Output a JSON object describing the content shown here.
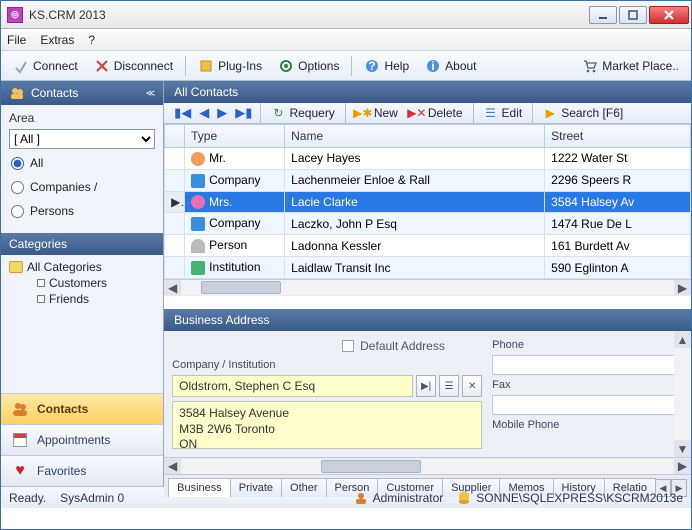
{
  "window": {
    "title": "KS.CRM 2013"
  },
  "menu": {
    "file": "File",
    "extras": "Extras",
    "help": "?"
  },
  "toolbar": {
    "connect": "Connect",
    "disconnect": "Disconnect",
    "plugins": "Plug-Ins",
    "options": "Options",
    "help": "Help",
    "about": "About",
    "marketplace": "Market Place.."
  },
  "sidebar": {
    "contacts_title": "Contacts",
    "area_label": "Area",
    "area_value": "[ All ]",
    "radio_all": "All",
    "radio_companies": "Companies /",
    "radio_persons": "Persons",
    "categories_title": "Categories",
    "tree": {
      "root": "All Categories",
      "child1": "Customers",
      "child2": "Friends"
    },
    "nav": {
      "contacts": "Contacts",
      "appointments": "Appointments",
      "favorites": "Favorites"
    }
  },
  "grid": {
    "title": "All Contacts",
    "tb": {
      "requery": "Requery",
      "new": "New",
      "delete": "Delete",
      "edit": "Edit",
      "search": "Search [F6]"
    },
    "cols": {
      "type": "Type",
      "name": "Name",
      "street": "Street"
    },
    "rows": [
      {
        "type": "Mr.",
        "icon": "ico-mr",
        "name": "Lacey Hayes",
        "street": "1222 Water St"
      },
      {
        "type": "Company",
        "icon": "ico-company",
        "name": "Lachenmeier Enloe & Rall",
        "street": "2296 Speers R"
      },
      {
        "type": "Mrs.",
        "icon": "ico-mrs",
        "name": "Lacie Clarke",
        "street": "3584 Halsey Av"
      },
      {
        "type": "Company",
        "icon": "ico-company",
        "name": "Laczko, John P Esq",
        "street": "1474 Rue De L"
      },
      {
        "type": "Person",
        "icon": "ico-person",
        "name": "Ladonna Kessler",
        "street": "161 Burdett Av"
      },
      {
        "type": "Institution",
        "icon": "ico-inst",
        "name": "Laidlaw Transit Inc",
        "street": "590 Eglinton A"
      }
    ]
  },
  "detail": {
    "title": "Business Address",
    "default_addr": "Default Address",
    "company_label": "Company / Institution",
    "company_value": "Oldstrom, Stephen C Esq",
    "address": "3584 Halsey Avenue\nM3B 2W6 Toronto\nON",
    "phone_label": "Phone",
    "fax_label": "Fax",
    "mobile_label": "Mobile Phone"
  },
  "tabs": {
    "items": [
      "Business",
      "Private",
      "Other",
      "Person",
      "Customer",
      "Supplier",
      "Memos",
      "History",
      "Relatio"
    ]
  },
  "status": {
    "ready": "Ready.",
    "sysadmin": "SysAdmin 0",
    "admin": "Administrator",
    "server": "SONNE\\SQLEXPRESS\\KSCRM2013e"
  }
}
